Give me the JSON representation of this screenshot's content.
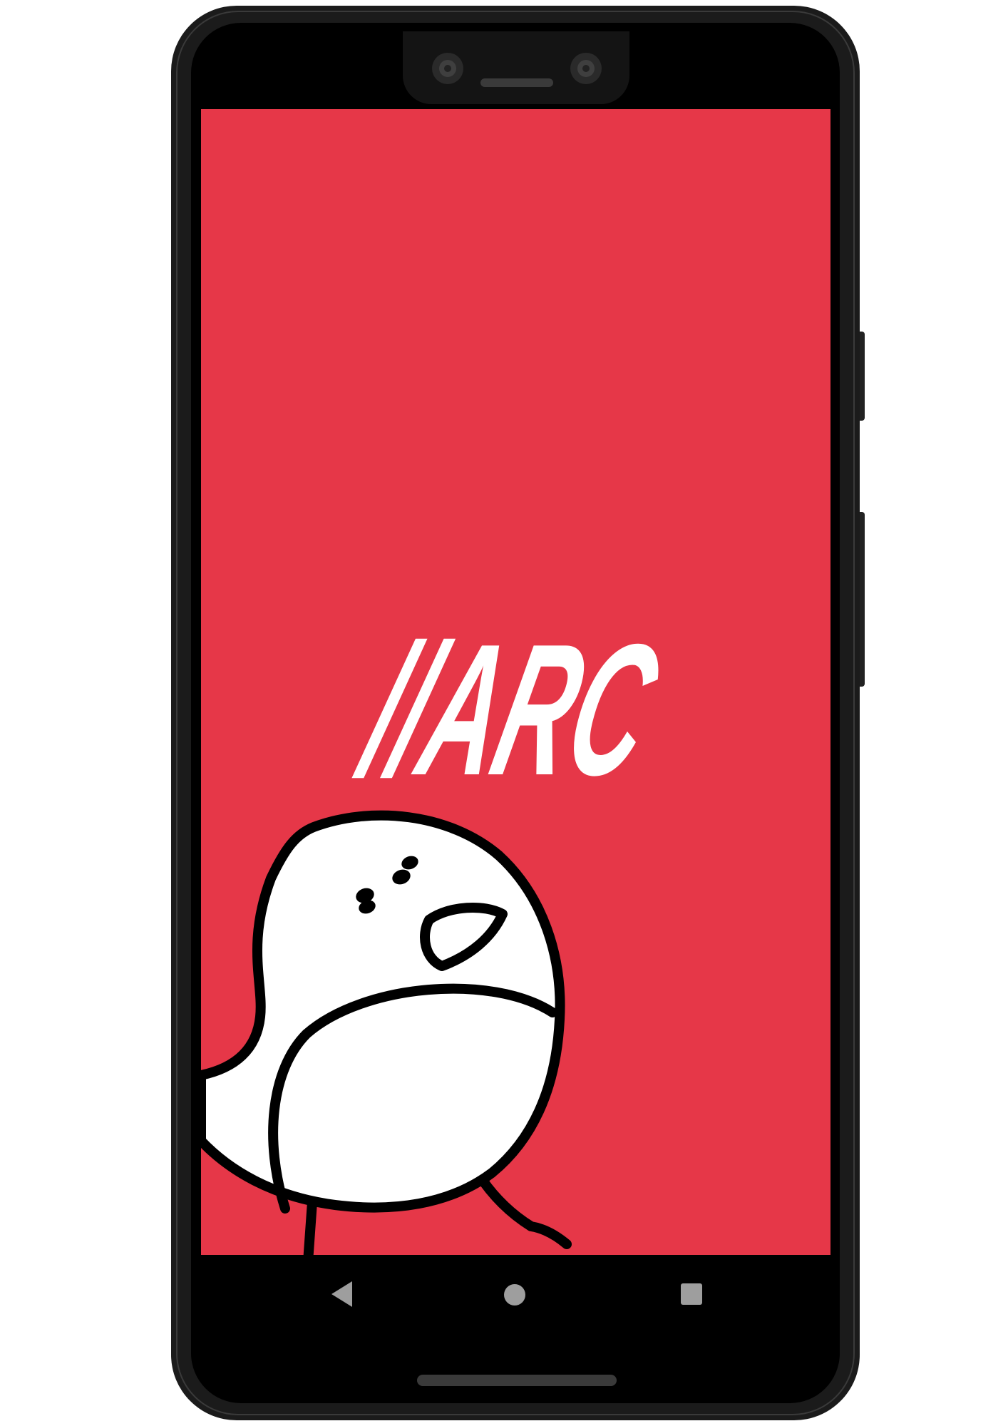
{
  "device": {
    "model": "phone",
    "frame_color": "#1b1b1b"
  },
  "splash": {
    "background_color": "#e63748",
    "logo_text": "//ARC",
    "logo_color": "#ffffff",
    "illustration": "bird-mascot-illustration"
  },
  "nav_bar": {
    "background_color": "#000000",
    "back_icon": "back-triangle-icon",
    "home_icon": "home-circle-icon",
    "recents_icon": "recents-square-icon",
    "icon_color": "#9e9e9e"
  }
}
